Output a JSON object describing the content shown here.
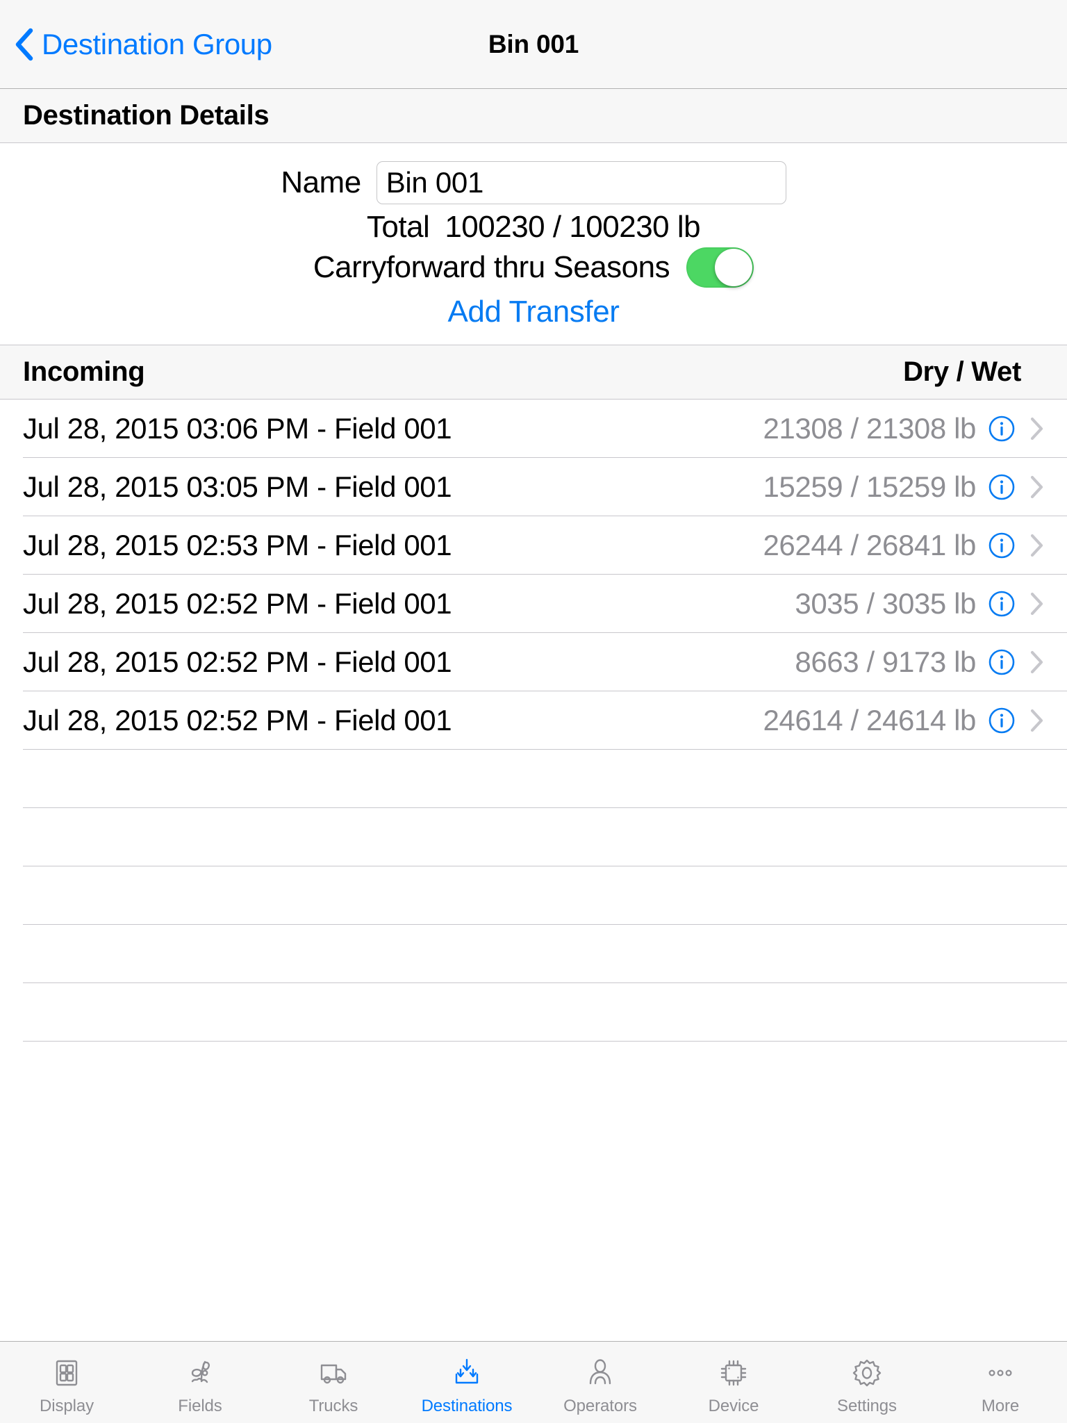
{
  "navbar": {
    "back_label": "Destination Group",
    "back_icon": "chevron-left-icon",
    "title": "Bin 001"
  },
  "details_section": {
    "header": "Destination Details",
    "name_label": "Name",
    "name_value": "Bin 001",
    "name_placeholder": "Name",
    "total_label": "Total",
    "total_value": "100230 / 100230 lb",
    "carryforward_label": "Carryforward thru Seasons",
    "carryforward_on": true,
    "toggle_on_color": "#4cd763",
    "add_transfer_label": "Add Transfer",
    "link_color": "#067bf2"
  },
  "list": {
    "header_left": "Incoming",
    "header_right": "Dry / Wet",
    "info_icon": "info-circle-icon",
    "disclosure_icon": "chevron-right-icon",
    "rows": [
      {
        "label": "Jul 28, 2015 03:06 PM - Field 001",
        "value": "21308 / 21308 lb"
      },
      {
        "label": "Jul 28, 2015 03:05 PM - Field 001",
        "value": "15259 / 15259 lb"
      },
      {
        "label": "Jul 28, 2015 02:53 PM - Field 001",
        "value": "26244 / 26841 lb"
      },
      {
        "label": "Jul 28, 2015 02:52 PM - Field 001",
        "value": "3035 / 3035 lb"
      },
      {
        "label": "Jul 28, 2015 02:52 PM - Field 001",
        "value": "8663 / 9173 lb"
      },
      {
        "label": "Jul 28, 2015 02:52 PM - Field 001",
        "value": "24614 / 24614 lb"
      }
    ],
    "empty_rows": 5
  },
  "tabbar": {
    "active_index": 3,
    "active_color": "#007aff",
    "inactive_color": "#8e8e93",
    "items": [
      {
        "label": "Display",
        "icon": "display-grid-icon"
      },
      {
        "label": "Fields",
        "icon": "plant-sprout-icon"
      },
      {
        "label": "Trucks",
        "icon": "truck-icon"
      },
      {
        "label": "Destinations",
        "icon": "arrows-into-bin-icon"
      },
      {
        "label": "Operators",
        "icon": "person-icon"
      },
      {
        "label": "Device",
        "icon": "chip-icon"
      },
      {
        "label": "Settings",
        "icon": "gear-icon"
      },
      {
        "label": "More",
        "icon": "ellipsis-icon"
      }
    ]
  }
}
